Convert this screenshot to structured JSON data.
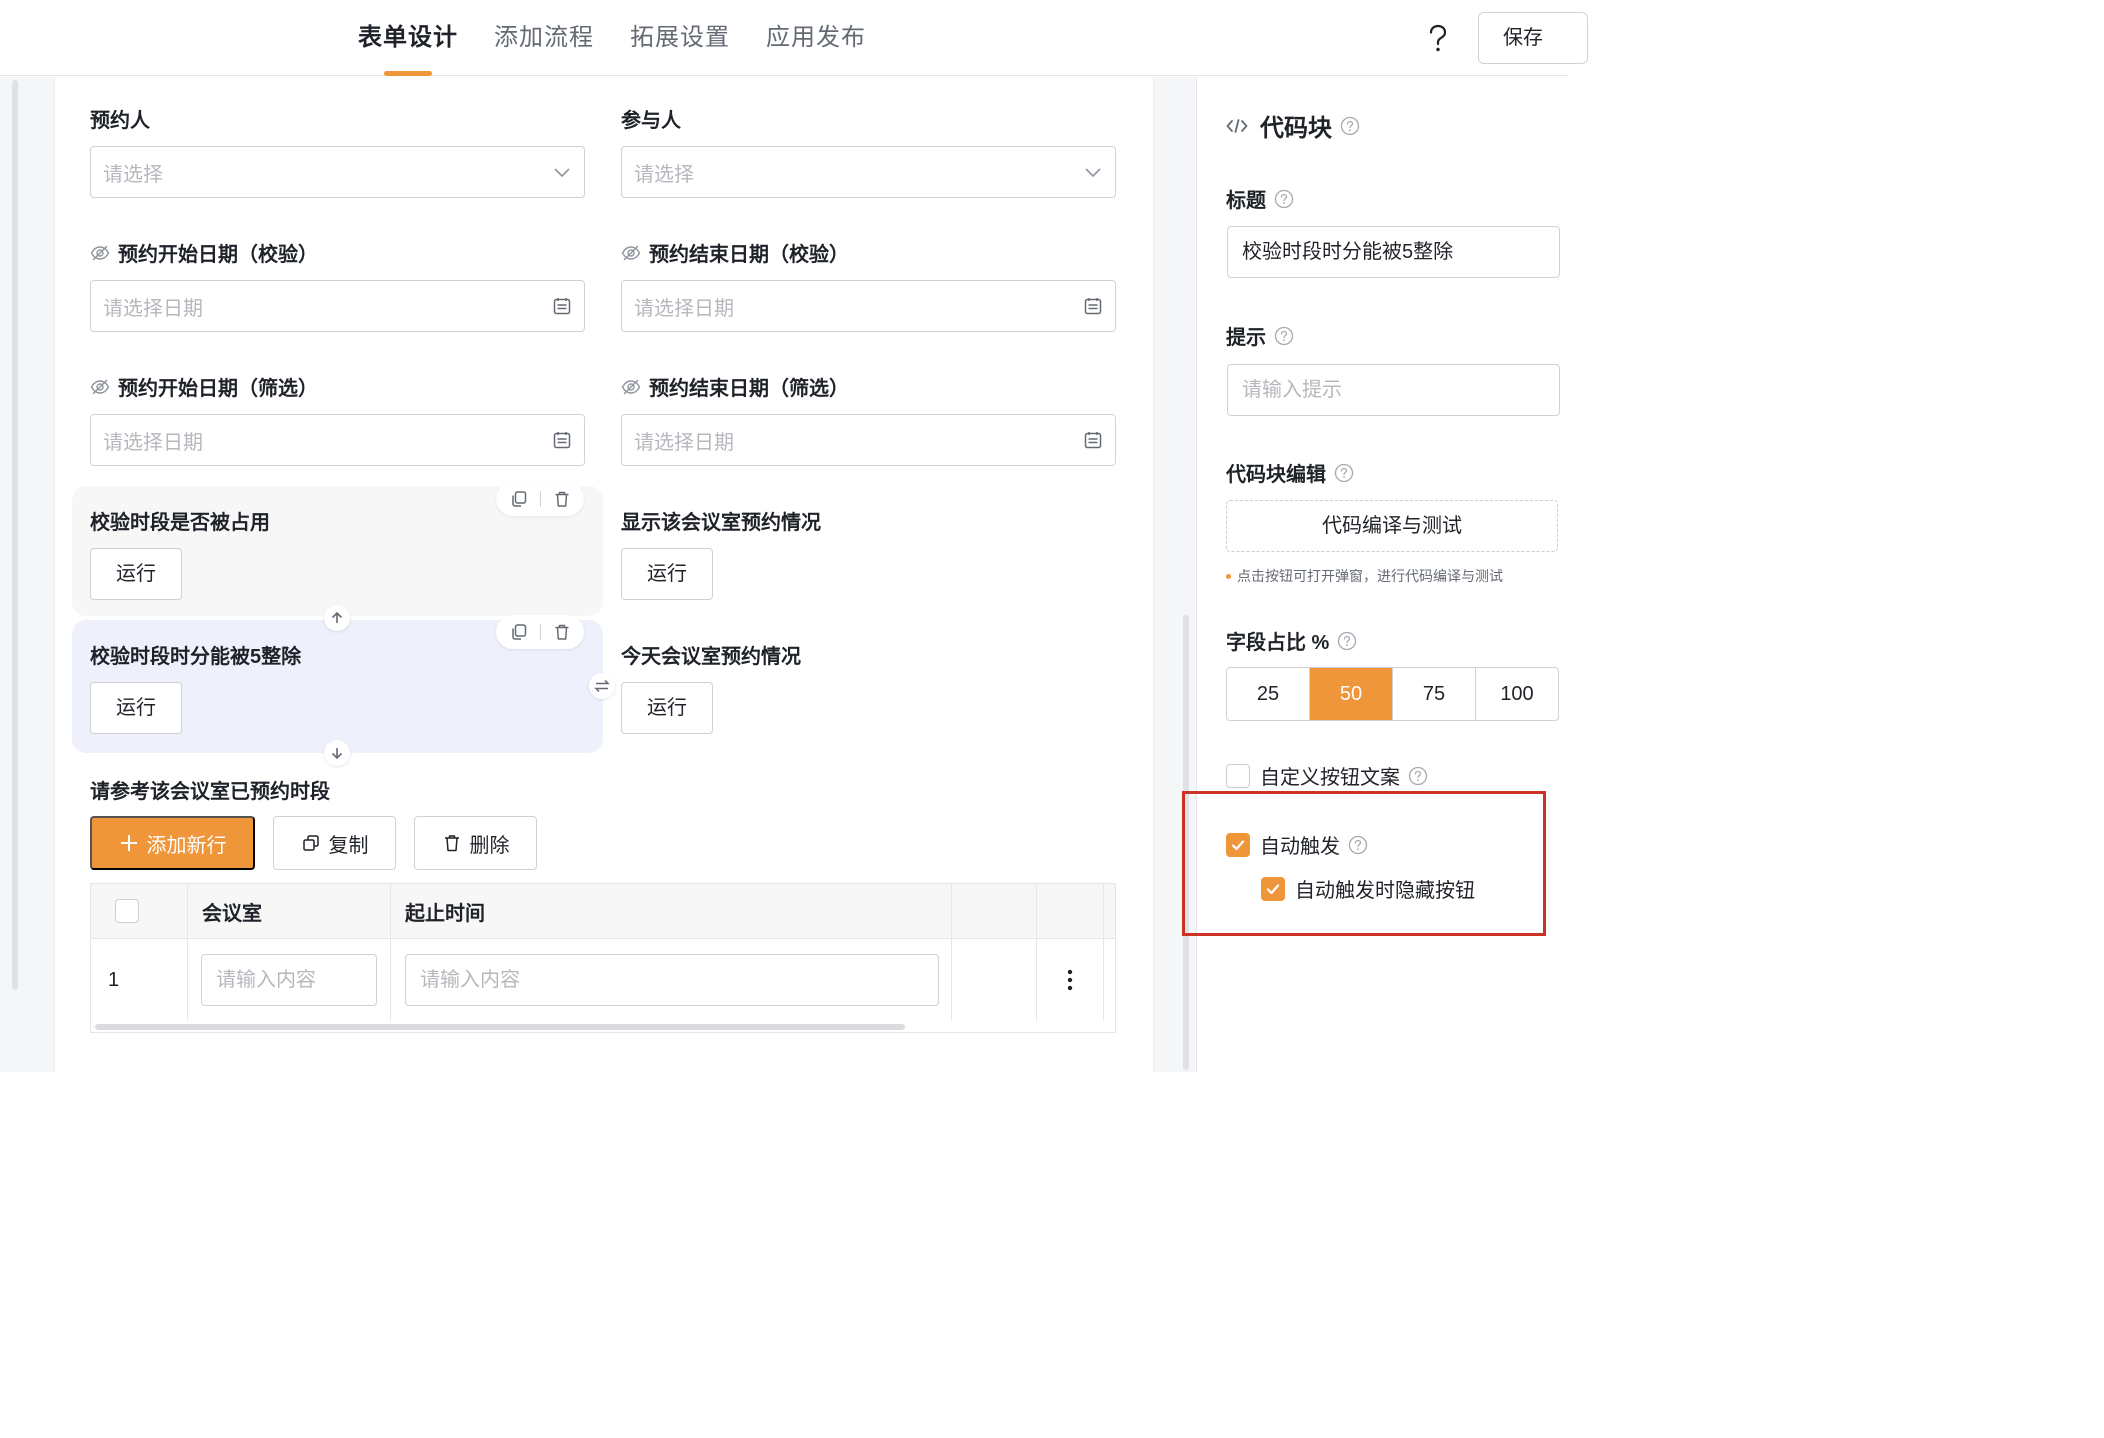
{
  "header": {
    "tabs": [
      {
        "label": "表单设计",
        "active": true
      },
      {
        "label": "添加流程",
        "active": false
      },
      {
        "label": "拓展设置",
        "active": false
      },
      {
        "label": "应用发布",
        "active": false
      }
    ],
    "help_icon": "question-icon",
    "save_label": "保存"
  },
  "form": {
    "booker": {
      "label": "预约人",
      "placeholder": "请选择"
    },
    "participants": {
      "label": "参与人",
      "placeholder": "请选择"
    },
    "start_date_check": {
      "label": "预约开始日期（校验）",
      "placeholder": "请选择日期"
    },
    "end_date_check": {
      "label": "预约结束日期（校验）",
      "placeholder": "请选择日期"
    },
    "start_date_filter": {
      "label": "预约开始日期（筛选）",
      "placeholder": "请选择日期"
    },
    "end_date_filter": {
      "label": "预约结束日期（筛选）",
      "placeholder": "请选择日期"
    },
    "code_blocks": [
      {
        "label": "校验时段是否被占用",
        "button": "运行"
      },
      {
        "label": "显示该会议室预约情况",
        "button": "运行"
      },
      {
        "label": "校验时段时分能被5整除",
        "button": "运行"
      },
      {
        "label": "今天会议室预约情况",
        "button": "运行"
      }
    ],
    "subtable": {
      "label": "请参考该会议室已预约时段",
      "add_button": "添加新行",
      "copy_button": "复制",
      "delete_button": "删除",
      "columns": [
        "会议室",
        "起止时间"
      ],
      "rows": [
        {
          "index": "1",
          "room_placeholder": "请输入内容",
          "time_placeholder": "请输入内容"
        }
      ]
    }
  },
  "panel": {
    "title": "代码块",
    "title_field": {
      "label": "标题",
      "value": "校验时段时分能被5整除"
    },
    "tip_field": {
      "label": "提示",
      "placeholder": "请输入提示"
    },
    "code_edit": {
      "label": "代码块编辑",
      "button": "代码编译与测试",
      "hint": "点击按钮可打开弹窗，进行代码编译与测试"
    },
    "width_ratio": {
      "label": "字段占比 %",
      "options": [
        "25",
        "50",
        "75",
        "100"
      ],
      "selected": "50"
    },
    "custom_button_text": {
      "label": "自定义按钮文案",
      "checked": false
    },
    "auto_trigger": {
      "label": "自动触发",
      "checked": true
    },
    "hide_button_on_auto": {
      "label": "自动触发时隐藏按钮",
      "checked": true
    }
  },
  "colors": {
    "accent": "#f0963a",
    "highlight_border": "#cc3326",
    "selected_block_bg": "#eef1fb"
  }
}
